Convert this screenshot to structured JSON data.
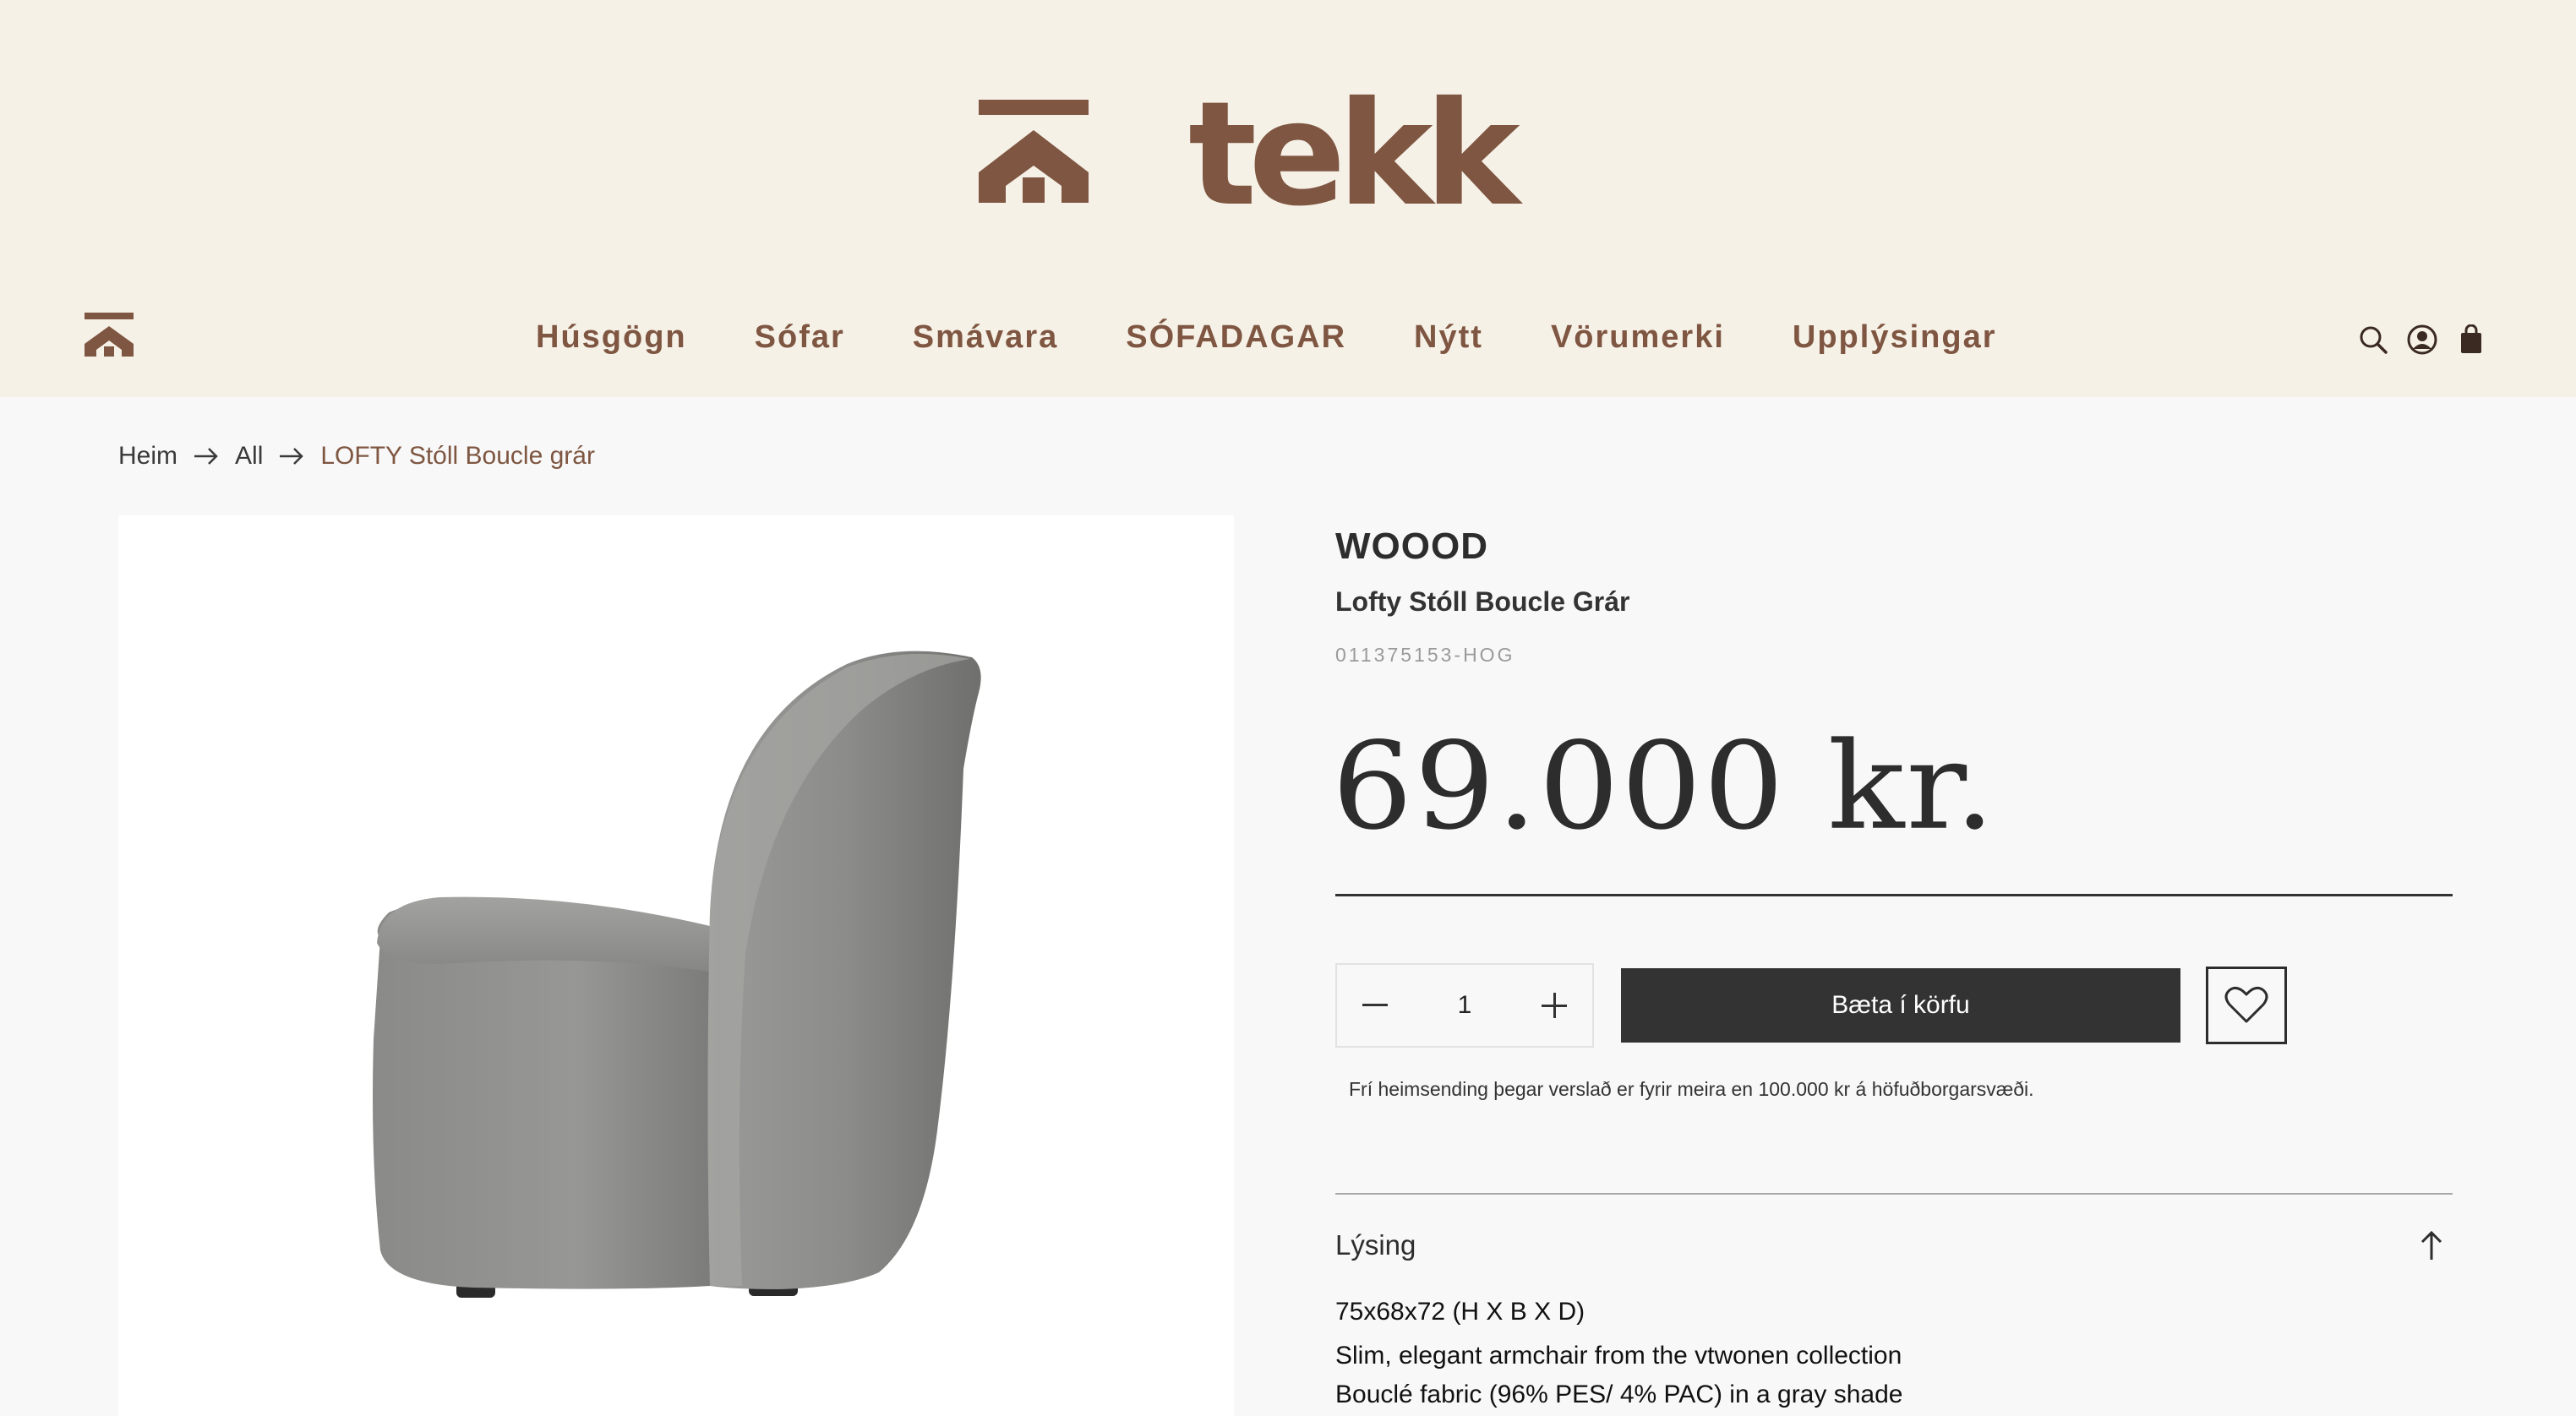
{
  "header": {
    "logo_text": "tekk",
    "nav": [
      "Húsgögn",
      "Sófar",
      "Smávara",
      "SÓFADAGAR",
      "Nýtt",
      "Vörumerki",
      "Upplýsingar"
    ],
    "icons": [
      "search-icon",
      "account-icon",
      "cart-bag-icon"
    ]
  },
  "breadcrumb": {
    "home": "Heim",
    "all": "All",
    "current": "LOFTY Stóll Boucle grár"
  },
  "product": {
    "brand": "WOOOD",
    "name": "Lofty Stóll Boucle Grár",
    "sku": "011375153-HOG",
    "price": "69.000 kr.",
    "quantity": "1",
    "add_to_cart": "Bæta í körfu",
    "shipping_note": "Frí heimsending þegar verslað er fyrir meira en 100.000 kr á höfuðborgarsvæði.",
    "description": {
      "title": "Lýsing",
      "lines": [
        "75x68x72 (H X B X D)",
        "Slim, elegant armchair from the vtwonen collection",
        "Bouclé fabric (96% PES/ 4% PAC) in a gray shade"
      ]
    }
  },
  "colors": {
    "brand_brown": "#7e5641",
    "header_bg": "#f6f1e7",
    "button_dark": "#333333"
  }
}
